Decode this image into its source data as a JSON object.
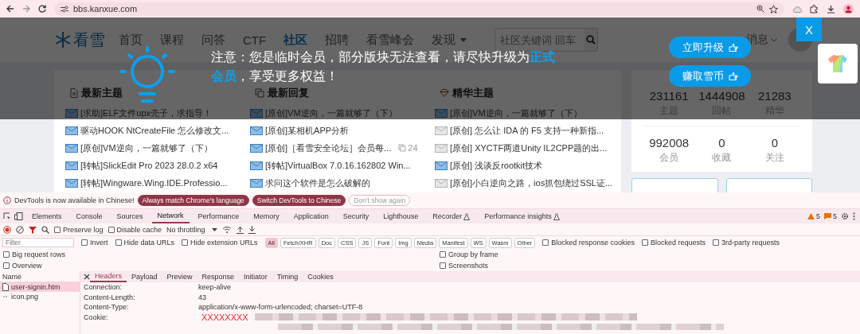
{
  "browser": {
    "url": "bbs.kanxue.com"
  },
  "site": {
    "logo": "看雪",
    "nav": [
      {
        "label": "首页",
        "selected": false,
        "dropdown": false
      },
      {
        "label": "课程",
        "selected": false,
        "dropdown": false
      },
      {
        "label": "问答",
        "selected": false,
        "dropdown": false
      },
      {
        "label": "CTF",
        "selected": false,
        "dropdown": false
      },
      {
        "label": "社区",
        "selected": true,
        "dropdown": false
      },
      {
        "label": "招聘",
        "selected": false,
        "dropdown": false
      },
      {
        "label": "看雪峰会",
        "selected": false,
        "dropdown": false
      },
      {
        "label": "发现",
        "selected": false,
        "dropdown": true
      }
    ],
    "search": {
      "placeholder": "社区关键词 回车"
    },
    "messages": "消息"
  },
  "columns": [
    {
      "title": "最新主题",
      "items": [
        {
          "text": "[求助]ELF文件upx壳子，求指导！",
          "unread": true
        },
        {
          "text": "驱动HOOK NtCreateFile 怎么修改文...",
          "unread": true
        },
        {
          "text": "[原创]VM逆向，一篇就够了（下）",
          "unread": true
        },
        {
          "text": "[转帖]SlickEdit Pro 2023 28.0.2 x64",
          "unread": true
        },
        {
          "text": "[转帖]Wingware.Wing.IDE.Professio...",
          "unread": true
        }
      ]
    },
    {
      "title": "最新回复",
      "items": [
        {
          "text": "[原创]VM逆向，一篇就够了（下）",
          "unread": true
        },
        {
          "text": "[原创]某相机APP分析",
          "unread": true
        },
        {
          "text": "[原创]［看雪安全论坛］会员每...",
          "unread": true,
          "replies": "24"
        },
        {
          "text": "[转帖]VirtualBox 7.0.16.162802 Win...",
          "unread": true
        },
        {
          "text": "求问这个软件是怎么破解的",
          "unread": true
        }
      ]
    },
    {
      "title": "精华主题",
      "items": [
        {
          "text": "[原创]VM逆向，一篇就够了（下）",
          "unread": true
        },
        {
          "text": "[原创] 怎么让 IDA 的 F5 支持一种新指...",
          "unread": false
        },
        {
          "text": "[原创] XYCTF两道Unity IL2CPP题的出...",
          "unread": false
        },
        {
          "text": "[原创] 浅谈反rootkit技术",
          "unread": true
        },
        {
          "text": "[原创]小白逆向之路，ios抓包绕过SSL证...",
          "unread": false
        }
      ]
    }
  ],
  "stats": [
    [
      {
        "value": "231161",
        "label": "主题"
      },
      {
        "value": "1444908",
        "label": "回帖"
      },
      {
        "value": "21283",
        "label": "精华"
      }
    ],
    [
      {
        "value": "992008",
        "label": "会员"
      },
      {
        "value": "0",
        "label": "收藏"
      },
      {
        "value": "0",
        "label": "关注"
      }
    ]
  ],
  "notice": {
    "text": "注意：您是临时会员，部分版块无法查看，请尽快升级为**正式会员**，享受更多权益！",
    "buttons": [
      "立即升级",
      "赚取雪币"
    ],
    "close": "X"
  },
  "devtools": {
    "infobar": {
      "message": "DevTools is now available in Chinese!",
      "buttons": [
        {
          "label": "Always match Chrome's language",
          "kind": "filled"
        },
        {
          "label": "Switch DevTools to Chinese",
          "kind": "filled"
        },
        {
          "label": "Don't show again",
          "kind": "outline"
        }
      ]
    },
    "tabs": [
      {
        "label": "Elements",
        "selected": false,
        "experimental": false
      },
      {
        "label": "Console",
        "selected": false,
        "experimental": false
      },
      {
        "label": "Sources",
        "selected": false,
        "experimental": false
      },
      {
        "label": "Network",
        "selected": true,
        "experimental": false
      },
      {
        "label": "Performance",
        "selected": false,
        "experimental": false
      },
      {
        "label": "Memory",
        "selected": false,
        "experimental": false
      },
      {
        "label": "Application",
        "selected": false,
        "experimental": false
      },
      {
        "label": "Security",
        "selected": false,
        "experimental": false
      },
      {
        "label": "Lighthouse",
        "selected": false,
        "experimental": false
      },
      {
        "label": "Recorder",
        "selected": false,
        "experimental": true
      },
      {
        "label": "Performance insights",
        "selected": false,
        "experimental": true
      }
    ],
    "warnings": "5",
    "issues": "5",
    "toolbar": {
      "checkboxes": [
        {
          "label": "Preserve log",
          "checked": false
        },
        {
          "label": "Disable cache",
          "checked": false
        }
      ],
      "throttling": "No throttling"
    },
    "filter": {
      "placeholder": "Filter",
      "checkboxes": [
        {
          "label": "Invert",
          "checked": false
        },
        {
          "label": "Hide data URLs",
          "checked": false
        },
        {
          "label": "Hide extension URLs",
          "checked": false
        }
      ],
      "chips": [
        {
          "label": "All",
          "selected": true
        },
        {
          "label": "Fetch/XHR",
          "selected": false
        },
        {
          "label": "Doc",
          "selected": false
        },
        {
          "label": "CSS",
          "selected": false
        },
        {
          "label": "JS",
          "selected": false
        },
        {
          "label": "Font",
          "selected": false
        },
        {
          "label": "Img",
          "selected": false
        },
        {
          "label": "Media",
          "selected": false
        },
        {
          "label": "Manifest",
          "selected": false
        },
        {
          "label": "WS",
          "selected": false
        },
        {
          "label": "Wasm",
          "selected": false
        },
        {
          "label": "Other",
          "selected": false
        }
      ],
      "more": [
        {
          "label": "Blocked response cookies",
          "checked": false
        },
        {
          "label": "Blocked requests",
          "checked": false
        },
        {
          "label": "3rd-party requests",
          "checked": false
        }
      ]
    },
    "options": [
      {
        "left": {
          "label": "Big request rows",
          "checked": false
        },
        "right": {
          "label": "Group by frame",
          "checked": false
        }
      },
      {
        "left": {
          "label": "Overview",
          "checked": false
        },
        "right": {
          "label": "Screenshots",
          "checked": false
        }
      }
    ],
    "name_header": "Name",
    "requests": [
      {
        "name": "user-signin.htm",
        "kind": "document",
        "selected": true
      },
      {
        "name": "icon.png",
        "kind": "other",
        "selected": false
      }
    ],
    "detail_tabs": [
      {
        "label": "Headers",
        "selected": true
      },
      {
        "label": "Payload",
        "selected": false
      },
      {
        "label": "Preview",
        "selected": false
      },
      {
        "label": "Response",
        "selected": false
      },
      {
        "label": "Initiator",
        "selected": false
      },
      {
        "label": "Timing",
        "selected": false
      },
      {
        "label": "Cookies",
        "selected": false
      }
    ],
    "headers": [
      {
        "name": "Connection:",
        "value": "keep-alive"
      },
      {
        "name": "Content-Length:",
        "value": "43"
      },
      {
        "name": "Content-Type:",
        "value": "application/x-www-form-urlencoded; charset=UTF-8"
      },
      {
        "name": "Cookie:",
        "value": "XXXXXXXX",
        "redacted": true
      }
    ]
  }
}
